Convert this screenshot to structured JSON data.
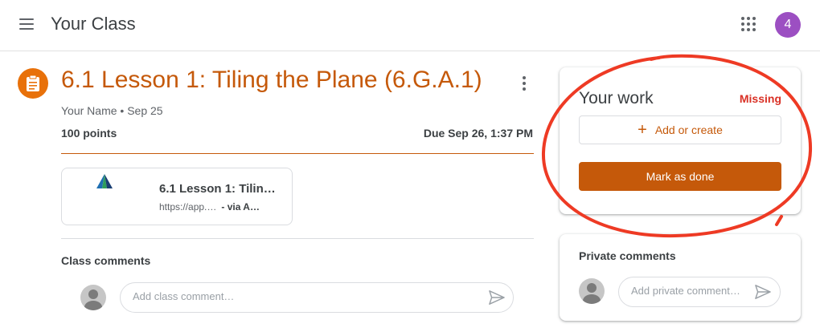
{
  "topbar": {
    "menu_icon": "hamburger-menu-icon",
    "title": "Your Class",
    "apps_icon": "apps-grid-icon",
    "avatar_letter": "4",
    "avatar_color": "#9c4fc2"
  },
  "assignment": {
    "icon": "assignment-clipboard-icon",
    "title": "6.1 Lesson 1: Tiling the Plane (6.G.A.1)",
    "author": "Your Name",
    "posted": "Sep 25",
    "points": "100 points",
    "due": "Due Sep 26, 1:37 PM",
    "accent_color": "#c5590a"
  },
  "attachment": {
    "logo": "app-logo-icon",
    "title": "6.1 Lesson 1: Tilin…",
    "url": "https://app.…",
    "via": "- via A…"
  },
  "class_comments": {
    "label": "Class comments",
    "placeholder": "Add class comment…"
  },
  "your_work": {
    "title": "Your work",
    "status": "Missing",
    "status_color": "#d93025",
    "add_label": "Add or create",
    "done_label": "Mark as done"
  },
  "private_comments": {
    "label": "Private comments",
    "placeholder": "Add private comment…"
  },
  "annotation_color": "#ee3a24"
}
